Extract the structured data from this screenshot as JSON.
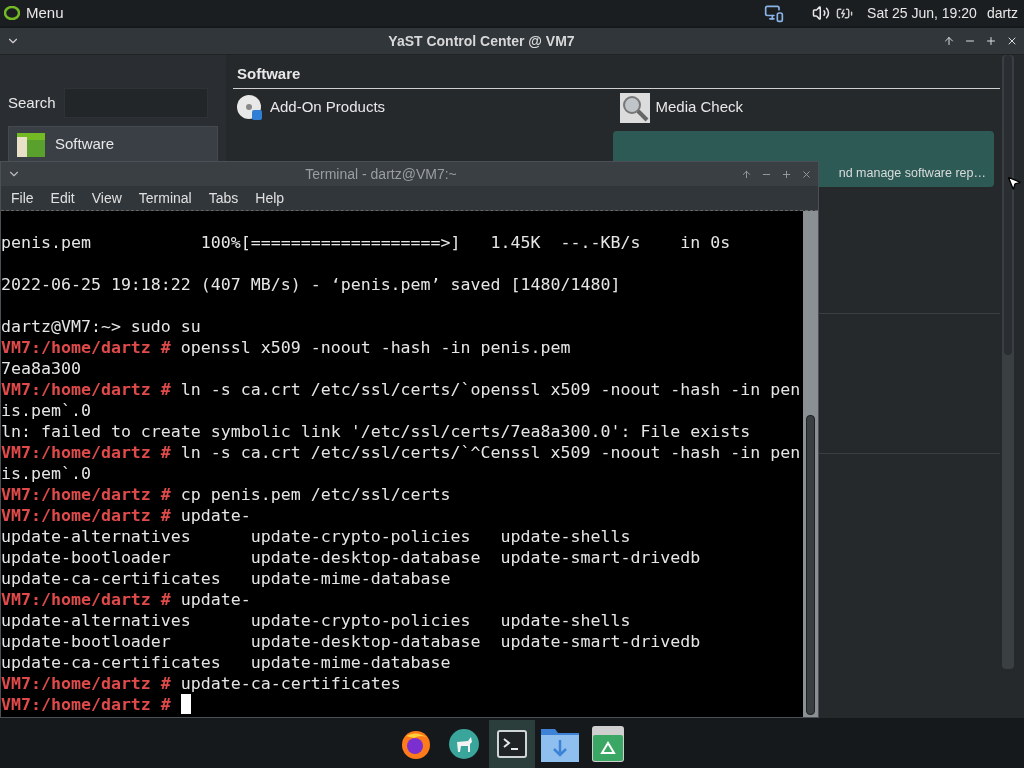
{
  "top_panel": {
    "menu_label": "Menu",
    "clock": "Sat 25 Jun, 19:20",
    "user": "dartz"
  },
  "yast": {
    "title": "YaST Control Center @ VM7",
    "search_label": "Search",
    "categories": [
      {
        "label": "Software",
        "selected": true
      }
    ],
    "section_title": "Software",
    "modules": [
      {
        "label": "Add-On Products",
        "kind": "disc",
        "selected": false
      },
      {
        "label": "Media Check",
        "kind": "magnifier",
        "selected": false
      }
    ],
    "highlighted_module": {
      "description": "nd manage software rep…",
      "selected": true
    }
  },
  "terminal": {
    "title": "Terminal - dartz@VM7:~",
    "menu": [
      "File",
      "Edit",
      "View",
      "Terminal",
      "Tabs",
      "Help"
    ],
    "lines": [
      {
        "blank_before": true,
        "text": "penis.pem           100%[===================>]   1.45K  --.-KB/s    in 0s"
      },
      {
        "blank_before": true,
        "text": "2022-06-25 19:18:22 (407 MB/s) - ‘penis.pem’ saved [1480/1480]"
      },
      {
        "blank_before": true,
        "text": "dartz@VM7:~> sudo su"
      },
      {
        "prompt": "VM7:/home/dartz #",
        "text": " openssl x509 -noout -hash -in penis.pem"
      },
      {
        "text": "7ea8a300"
      },
      {
        "prompt": "VM7:/home/dartz #",
        "text": " ln -s ca.crt /etc/ssl/certs/`openssl x509 -noout -hash -in pen"
      },
      {
        "text": "is.pem`.0"
      },
      {
        "text": "ln: failed to create symbolic link '/etc/ssl/certs/7ea8a300.0': File exists"
      },
      {
        "prompt": "VM7:/home/dartz #",
        "text": " ln -s ca.crt /etc/ssl/certs/`^Censsl x509 -noout -hash -in pen"
      },
      {
        "text": "is.pem`.0"
      },
      {
        "prompt": "VM7:/home/dartz #",
        "text": " cp penis.pem /etc/ssl/certs"
      },
      {
        "prompt": "VM7:/home/dartz #",
        "text": " update-"
      },
      {
        "text": "update-alternatives      update-crypto-policies   update-shells"
      },
      {
        "text": "update-bootloader        update-desktop-database  update-smart-drivedb"
      },
      {
        "text": "update-ca-certificates   update-mime-database"
      },
      {
        "prompt": "VM7:/home/dartz #",
        "text": " update-"
      },
      {
        "text": "update-alternatives      update-crypto-policies   update-shells"
      },
      {
        "text": "update-bootloader        update-desktop-database  update-smart-drivedb"
      },
      {
        "text": "update-ca-certificates   update-mime-database"
      },
      {
        "prompt": "VM7:/home/dartz #",
        "text": " update-ca-certificates"
      },
      {
        "prompt": "VM7:/home/dartz #",
        "cursor": true
      }
    ]
  },
  "dock": [
    {
      "kind": "browser",
      "active": false
    },
    {
      "kind": "mastodon",
      "active": false
    },
    {
      "kind": "terminal",
      "active": true
    },
    {
      "kind": "downloads",
      "active": false
    },
    {
      "kind": "trash",
      "active": false
    }
  ]
}
